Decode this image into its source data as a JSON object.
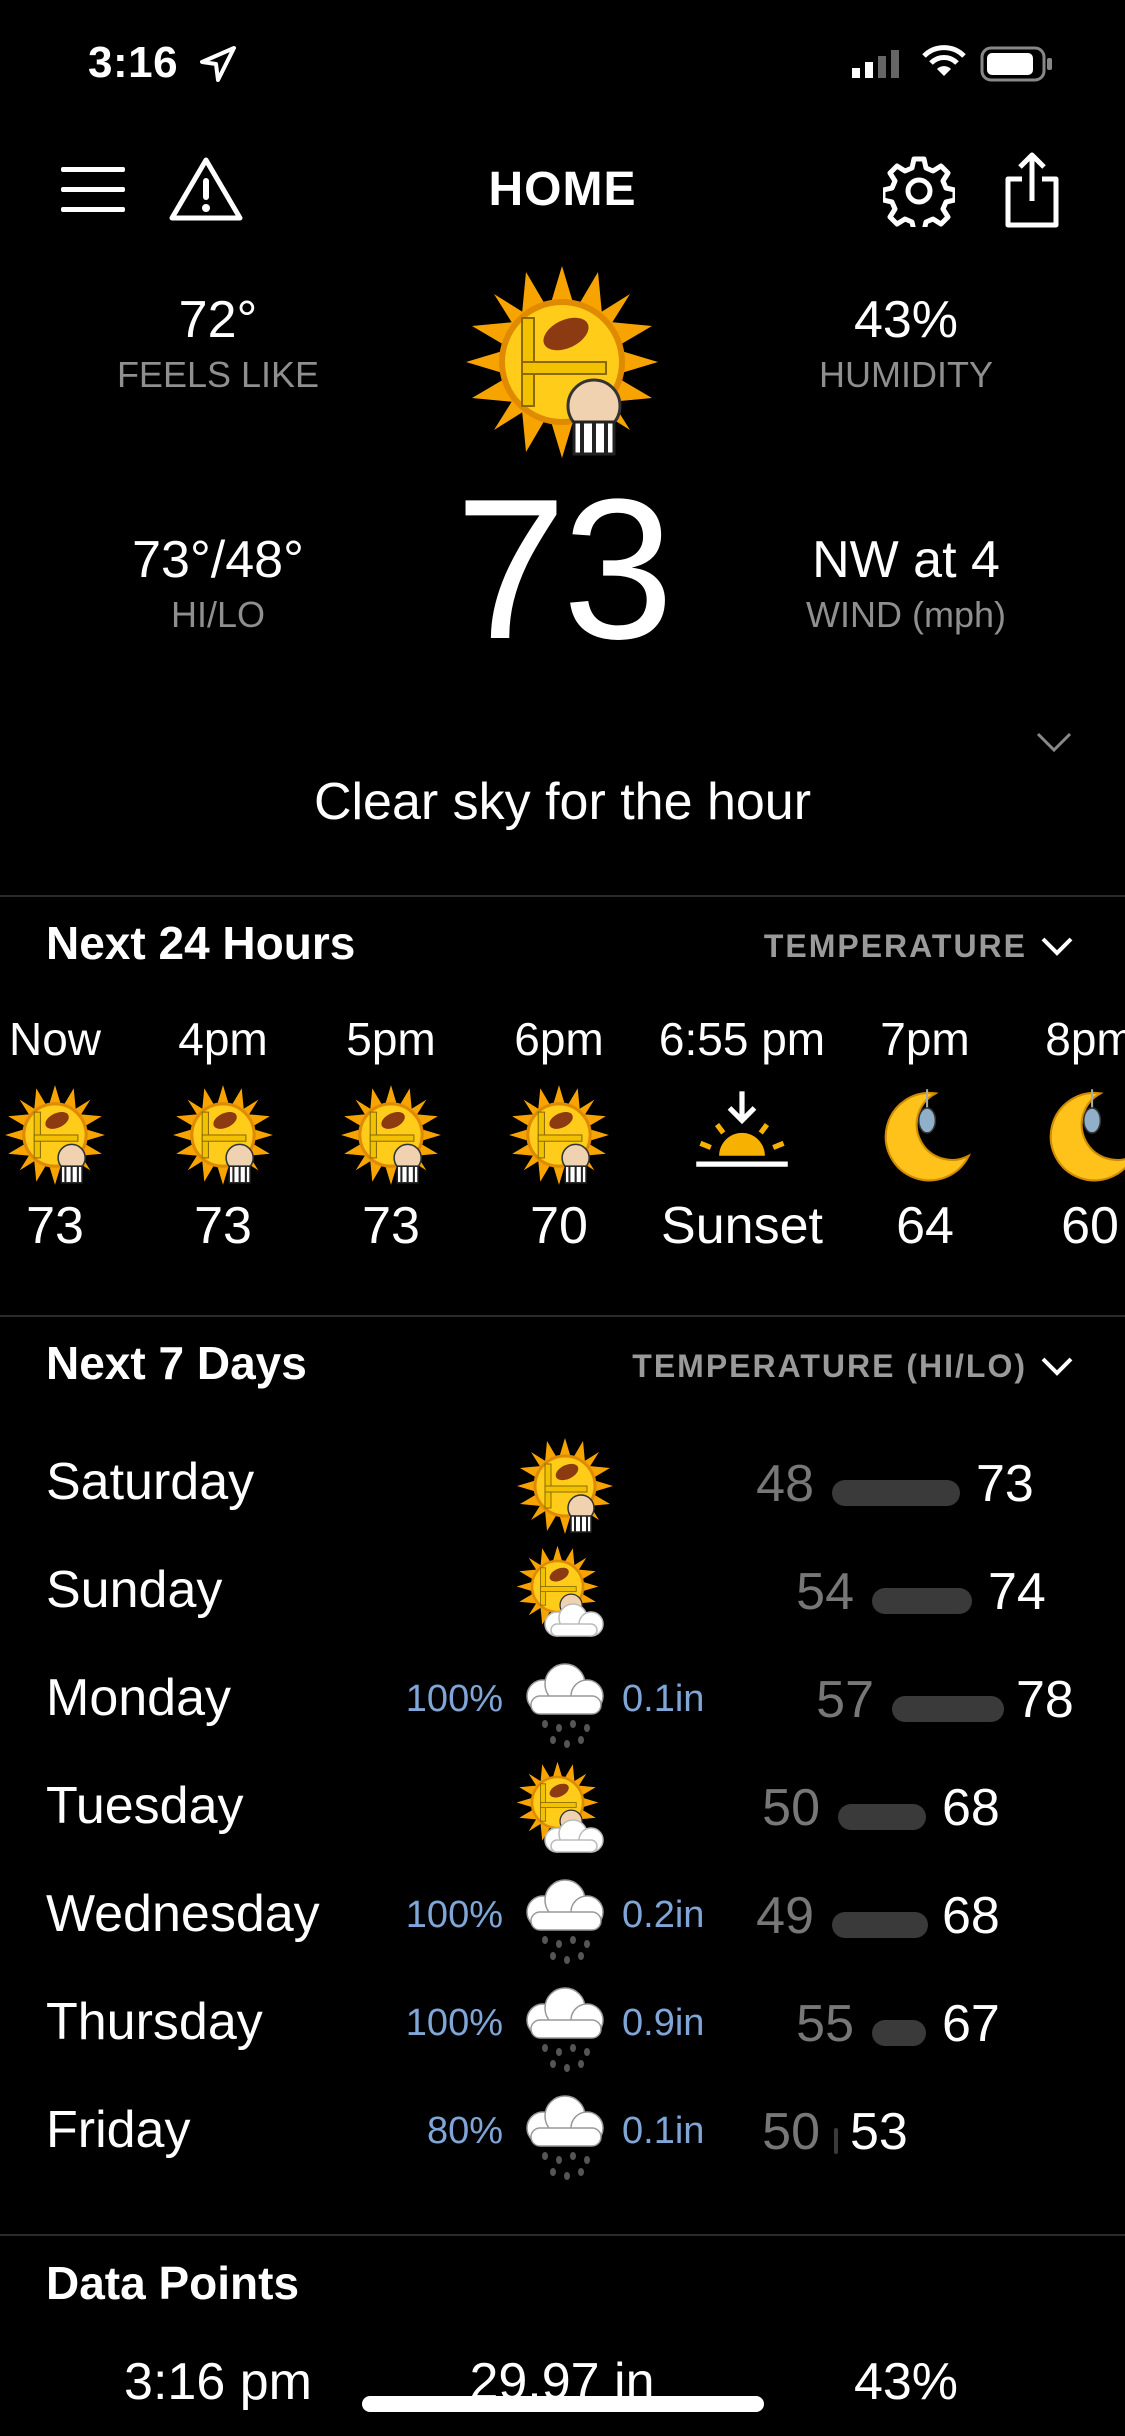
{
  "status_bar": {
    "time": "3:16"
  },
  "nav": {
    "title": "HOME"
  },
  "current": {
    "feels_like": {
      "value": "72°",
      "label": "FEELS LIKE"
    },
    "humidity": {
      "value": "43%",
      "label": "HUMIDITY"
    },
    "hi_lo": {
      "value": "73°/48°",
      "label": "HI/LO"
    },
    "wind": {
      "value": "NW at 4",
      "label": "WIND (mph)"
    },
    "temperature": "73",
    "summary": "Clear sky for the hour"
  },
  "hourly": {
    "title": "Next 24 Hours",
    "selector": "TEMPERATURE",
    "items": [
      {
        "time": "Now",
        "icon": "sun-football-icon",
        "value": "73"
      },
      {
        "time": "4pm",
        "icon": "sun-football-icon",
        "value": "73"
      },
      {
        "time": "5pm",
        "icon": "sun-football-icon",
        "value": "73"
      },
      {
        "time": "6pm",
        "icon": "sun-football-icon",
        "value": "70"
      },
      {
        "time": "6:55 pm",
        "icon": "sunset-icon",
        "value": "Sunset"
      },
      {
        "time": "7pm",
        "icon": "moon-icon",
        "value": "64"
      },
      {
        "time": "8pm",
        "icon": "moon-icon",
        "value": "60"
      }
    ]
  },
  "daily": {
    "title": "Next 7 Days",
    "selector": "TEMPERATURE (HI/LO)",
    "days": [
      {
        "name": "Saturday",
        "precip": "",
        "amount": "",
        "icon": "sun-football-icon",
        "lo": "48",
        "hi": "73"
      },
      {
        "name": "Sunday",
        "precip": "",
        "amount": "",
        "icon": "partly-cloudy-football-icon",
        "lo": "54",
        "hi": "74"
      },
      {
        "name": "Monday",
        "precip": "100%",
        "amount": "0.1in",
        "icon": "rain-cloud-icon",
        "lo": "57",
        "hi": "78"
      },
      {
        "name": "Tuesday",
        "precip": "",
        "amount": "",
        "icon": "partly-cloudy-football-icon",
        "lo": "50",
        "hi": "68"
      },
      {
        "name": "Wednesday",
        "precip": "100%",
        "amount": "0.2in",
        "icon": "rain-cloud-icon",
        "lo": "49",
        "hi": "68"
      },
      {
        "name": "Thursday",
        "precip": "100%",
        "amount": "0.9in",
        "icon": "rain-cloud-icon",
        "lo": "55",
        "hi": "67"
      },
      {
        "name": "Friday",
        "precip": "80%",
        "amount": "0.1in",
        "icon": "rain-cloud-icon",
        "lo": "50",
        "hi": "53"
      }
    ]
  },
  "data_points": {
    "title": "Data Points",
    "items": [
      {
        "value": "3:16 pm"
      },
      {
        "value": "29.97 in"
      },
      {
        "value": "43%"
      }
    ]
  },
  "colors": {
    "background": "#000000",
    "precip": "#7fa6d6",
    "muted": "#8f8f8f",
    "sun": "#f5a900"
  }
}
